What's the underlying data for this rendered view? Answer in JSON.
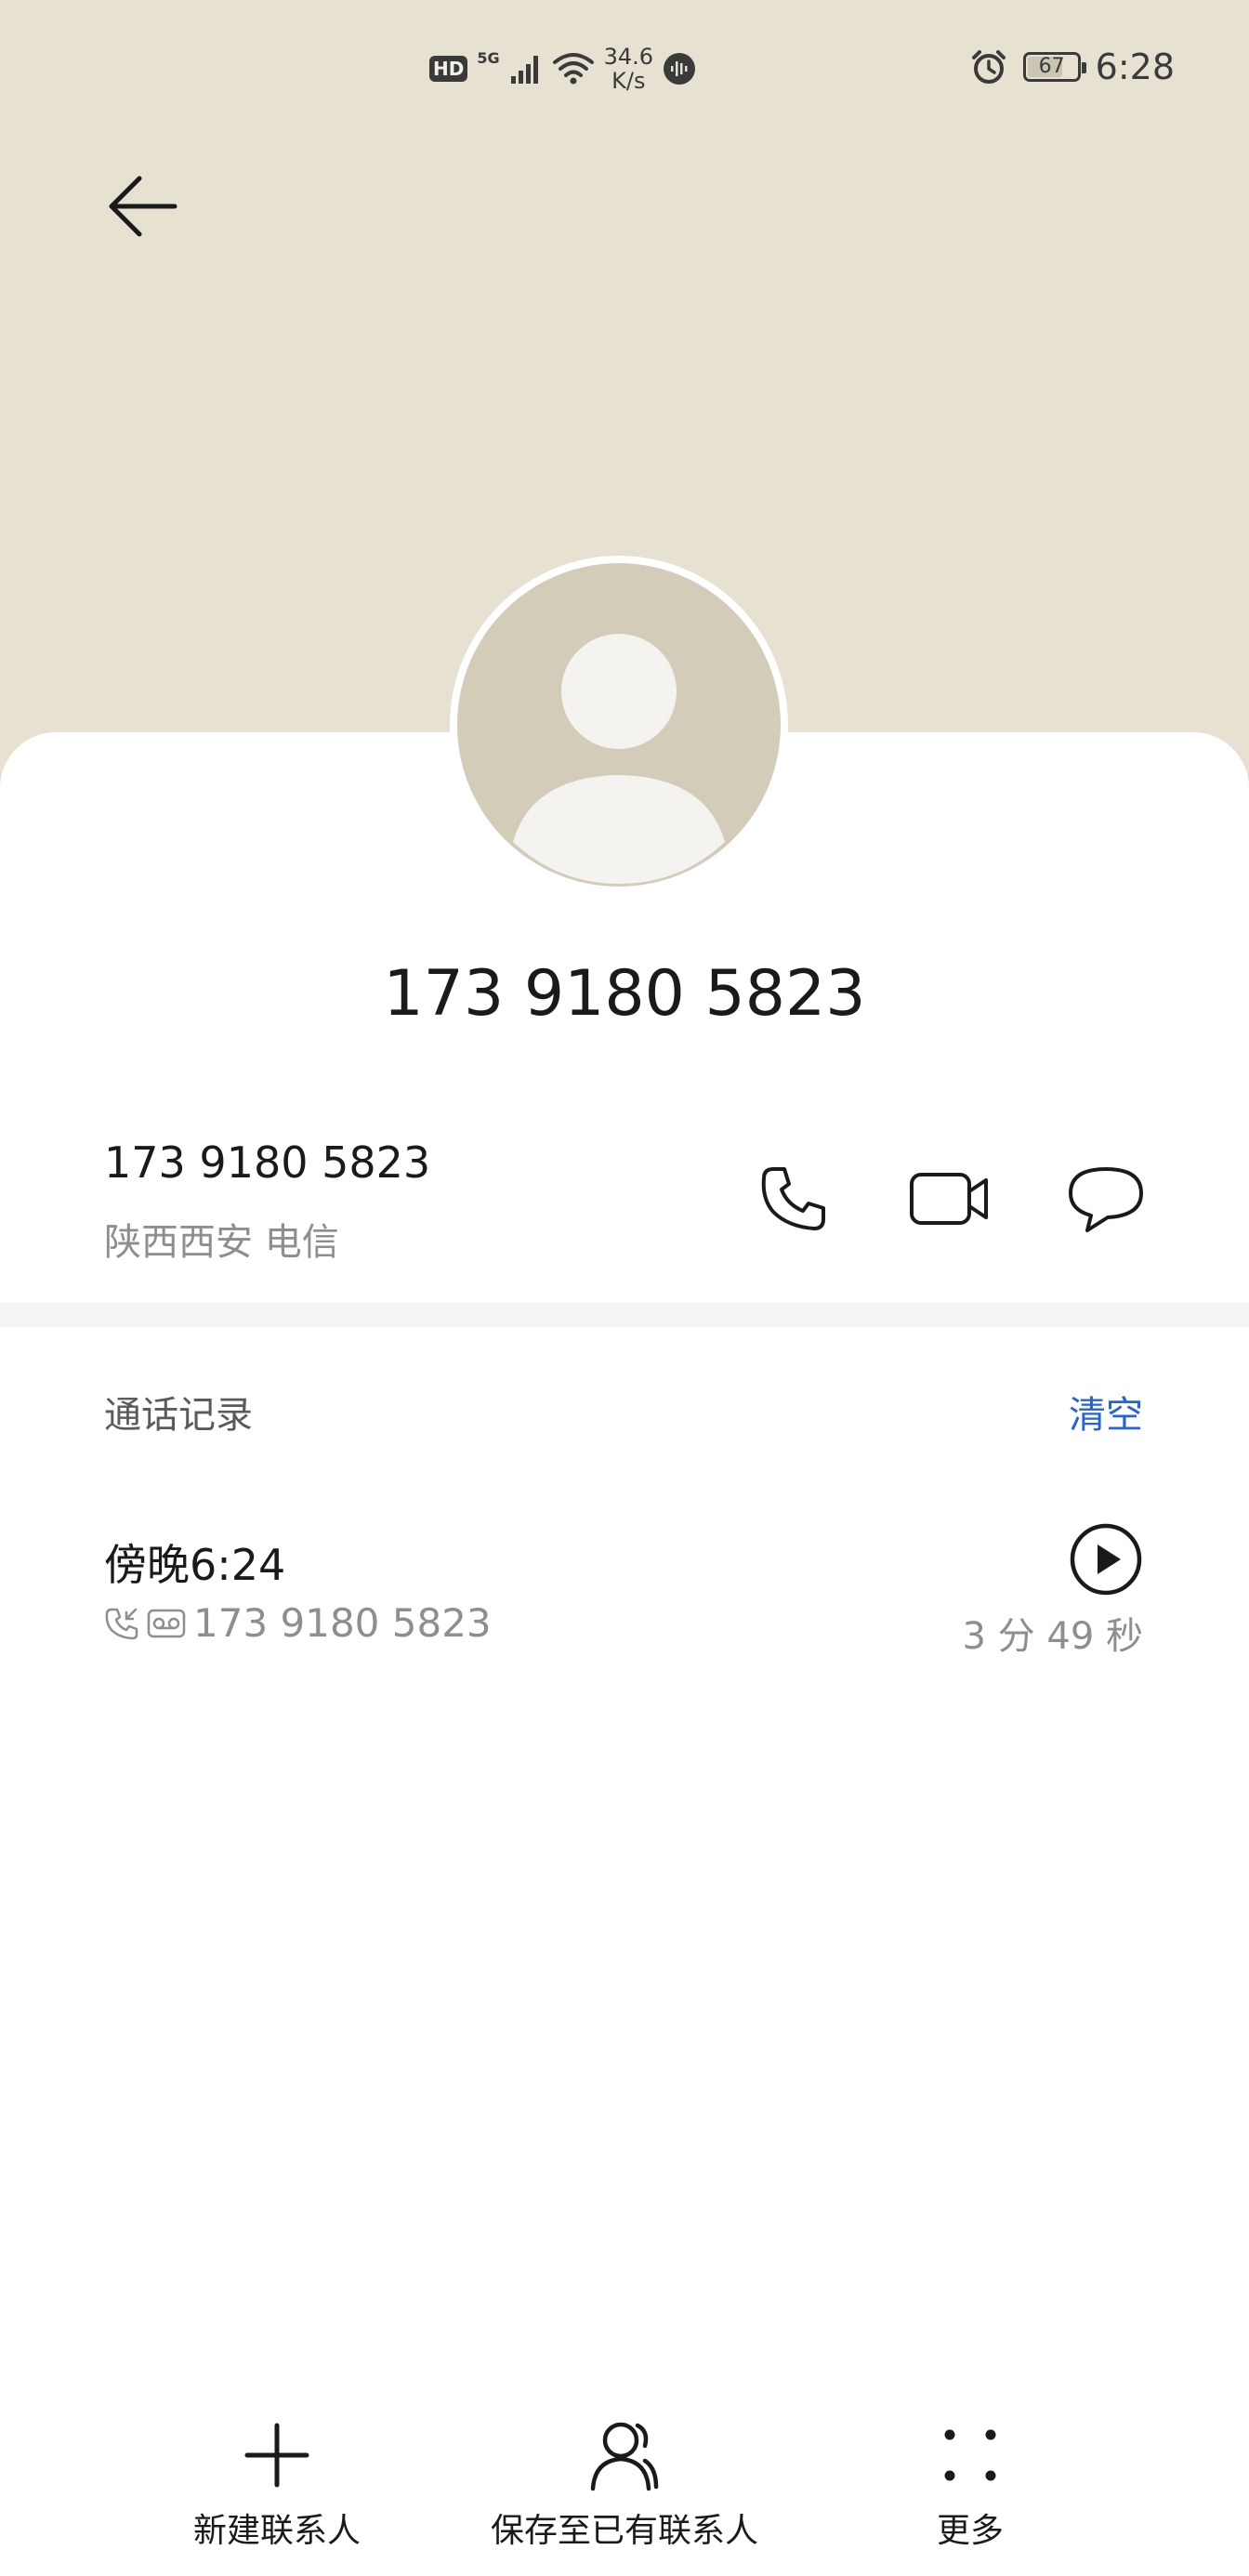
{
  "status_bar": {
    "hd": "HD",
    "signal_label": "5G",
    "net_speed_value": "34.6",
    "net_speed_unit": "K/s",
    "battery_level": "67",
    "time": "6:28"
  },
  "header": {
    "back_icon": "arrow-left-icon",
    "avatar_icon": "default-person-avatar"
  },
  "contact": {
    "title_number": "173 9180 5823",
    "number": "173 9180 5823",
    "location": "陕西西安 电信"
  },
  "actions": {
    "call_icon": "phone-icon",
    "video_icon": "video-camera-icon",
    "message_icon": "chat-bubble-icon"
  },
  "call_log": {
    "section_title": "通话记录",
    "clear_label": "清空",
    "entries": [
      {
        "time": "傍晚6:24",
        "number": "173 9180 5823",
        "duration": "3 分 49 秒",
        "type_icon": "incoming-call-icon",
        "recording_icon": "voicemail-icon"
      }
    ]
  },
  "bottom_bar": {
    "new_contact": "新建联系人",
    "save_existing": "保存至已有联系人",
    "more": "更多"
  },
  "colors": {
    "header_bg": "#e6e1d0",
    "accent": "#2563d6",
    "avatar_bg": "#d2ccb8"
  }
}
